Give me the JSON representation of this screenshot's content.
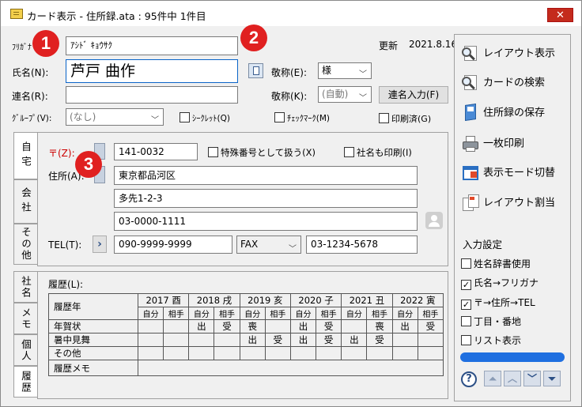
{
  "window": {
    "title": "カード表示 - 住所録.ata : 95件中 1件目",
    "close": "✕"
  },
  "header": {
    "furigana_label": "ﾌﾘｶﾞﾅ",
    "furigana_value": "ｱｼﾄﾞ ｷｮｳｻｸ",
    "updated_label": "更新",
    "updated_value": "2021.8.16",
    "name_label": "氏名(N):",
    "name_value": "芦戸 曲作",
    "honorific_e_label": "敬称(E):",
    "honorific_e_value": "様",
    "joint_label": "連名(R):",
    "honorific_k_label": "敬称(K):",
    "honorific_k_value": "(自動)",
    "joint_button": "連名入力(F)",
    "group_label": "ｸﾞﾙｰﾌﾟ(V):",
    "group_value": "(なし)",
    "secret_label": "ｼｰｸﾚｯﾄ(Q)",
    "checkmark_label": "ﾁｪｯｸﾏｰｸ(M)",
    "printed_label": "印刷済(G)"
  },
  "badges": [
    "1",
    "2",
    "3"
  ],
  "tabs": [
    {
      "label": "自宅"
    },
    {
      "label": "会社"
    },
    {
      "label": "その他"
    },
    {
      "label": "社名"
    },
    {
      "label": "メモ"
    },
    {
      "label": "個人"
    },
    {
      "label": "履歴"
    }
  ],
  "home": {
    "zip_label": "〒(Z):",
    "zip_value": "141-0032",
    "special_zip_label": "特殊番号として扱う(X)",
    "print_company_label": "社名も印刷(I)",
    "address_label": "住所(A):",
    "address1": "東京都品河区",
    "address2": "多先1-2-3",
    "address3": "03-0000-1111",
    "tel_label": "TEL(T):",
    "tel_value": "090-9999-9999",
    "fax_type": "FAX",
    "fax_value": "03-1234-5678",
    "arrow": "›"
  },
  "history": {
    "label": "履歴(L):",
    "year_header": "履歴年",
    "years": [
      "2017 酉",
      "2018 戌",
      "2019 亥",
      "2020 子",
      "2021 丑",
      "2022 寅"
    ],
    "self_label": "自分",
    "other_label": "相手",
    "rows": [
      {
        "name": "年賀状",
        "cells": [
          "",
          "",
          "出",
          "受",
          "喪",
          "",
          "出",
          "受",
          "",
          "喪",
          "出",
          "受"
        ]
      },
      {
        "name": "暑中見舞",
        "cells": [
          "",
          "",
          "",
          "",
          "出",
          "受",
          "出",
          "受",
          "出",
          "受",
          "",
          ""
        ]
      },
      {
        "name": "その他",
        "cells": [
          "",
          "",
          "",
          "",
          "",
          "",
          "",
          "",
          "",
          "",
          "",
          ""
        ]
      }
    ],
    "memo_label": "履歴メモ"
  },
  "sidebar": {
    "items": [
      {
        "label": "レイアウト表示",
        "icon": "magnifier-layout-icon"
      },
      {
        "label": "カードの検索",
        "icon": "magnifier-search-icon"
      },
      {
        "label": "住所録の保存",
        "icon": "save-addressbook-icon"
      },
      {
        "label": "一枚印刷",
        "icon": "printer-icon"
      },
      {
        "label": "表示モード切替",
        "icon": "display-mode-icon"
      },
      {
        "label": "レイアウト割当",
        "icon": "layout-assign-icon"
      }
    ],
    "settings_title": "入力設定",
    "settings": [
      {
        "label": "姓名辞書使用",
        "checked": false
      },
      {
        "label": "氏名→フリガナ",
        "checked": true
      },
      {
        "label": "〒→住所→TEL",
        "checked": true
      },
      {
        "label": "丁目・番地",
        "checked": false
      },
      {
        "label": "リスト表示",
        "checked": false
      }
    ],
    "help": "?",
    "nav": [
      "⏫",
      "︿",
      "﹀",
      "⏬"
    ]
  },
  "colors": {
    "badge": "#e02020",
    "progress": "#1f6fe0",
    "accent": "#0a64c8"
  }
}
